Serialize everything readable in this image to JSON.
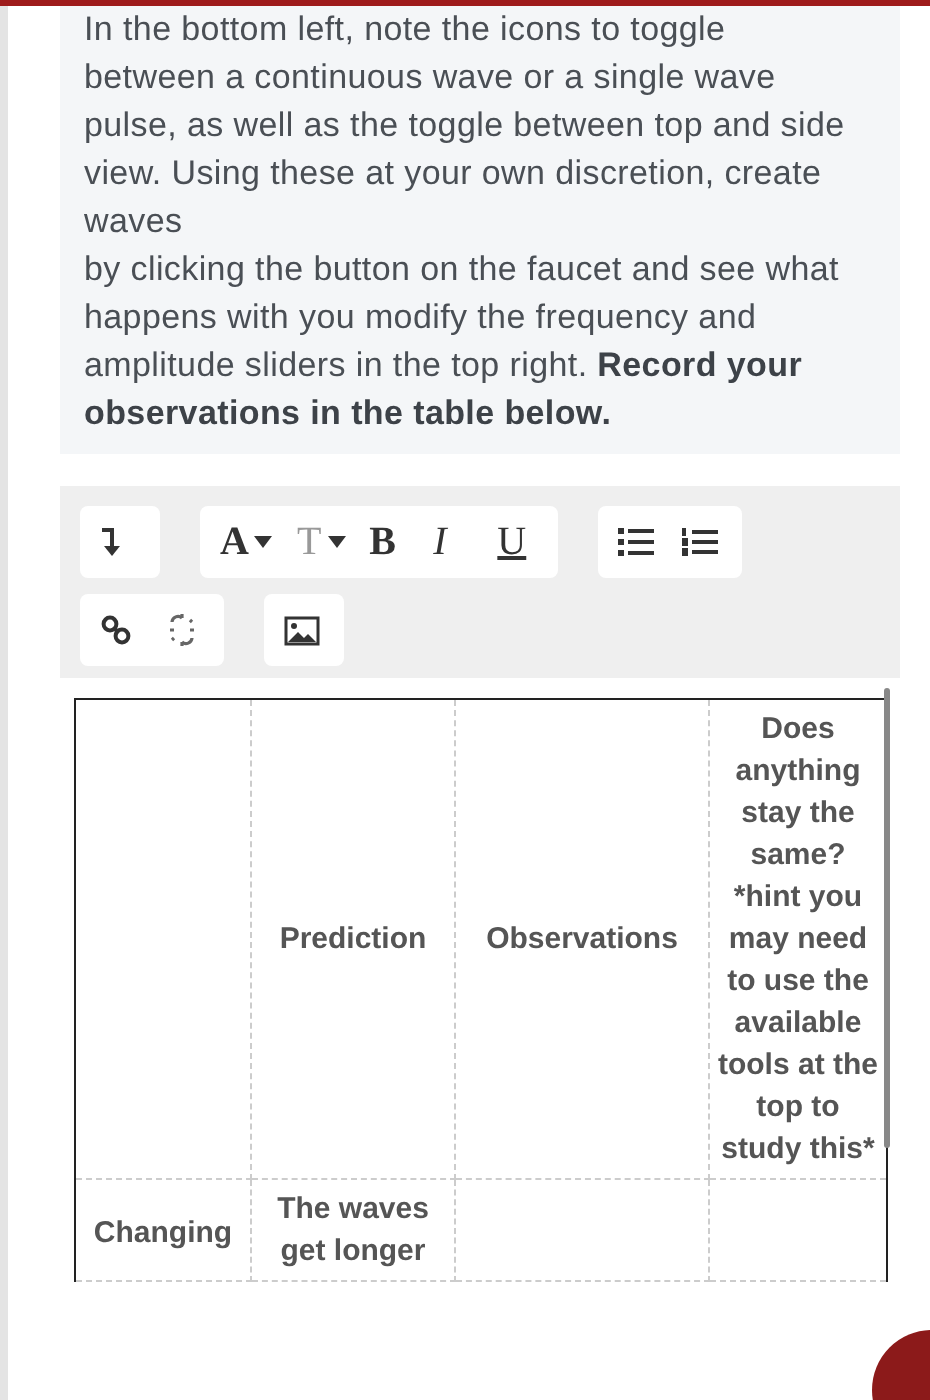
{
  "instructions": "In the bottom left, note the icons to toggle between a continuous wave or a single wave pulse, as well as the toggle between top and side view. Using these at your own discretion, create waves\nby clicking the button on the faucet and see what happens with you modify the frequency and amplitude sliders in the top right. **Record your observations in the table below.**",
  "toolbar": {
    "rows": [
      [
        {
          "items": [
            {
              "kind": "icon"
            }
          ]
        },
        {
          "items": [
            {
              "kind": "menu",
              "label": "A"
            },
            {
              "kind": "menu",
              "label": "T"
            },
            {
              "kind": "text",
              "label": "B"
            },
            {
              "kind": "text",
              "label": "I"
            },
            {
              "kind": "text",
              "label": "U"
            }
          ]
        },
        {
          "items": [
            {
              "kind": "icon"
            },
            {
              "kind": "icon"
            }
          ]
        }
      ],
      [
        {
          "items": [
            {
              "kind": "icon"
            },
            {
              "kind": "icon"
            }
          ]
        },
        {
          "items": [
            {
              "kind": "icon"
            }
          ]
        }
      ]
    ]
  },
  "table": {
    "rows": [
      [
        "",
        "Prediction",
        "Observations",
        "Does anything stay the same? *hint you may need to use the available tools at the top to study this*"
      ],
      [
        "Changing",
        "The waves get longer",
        "",
        ""
      ]
    ]
  }
}
